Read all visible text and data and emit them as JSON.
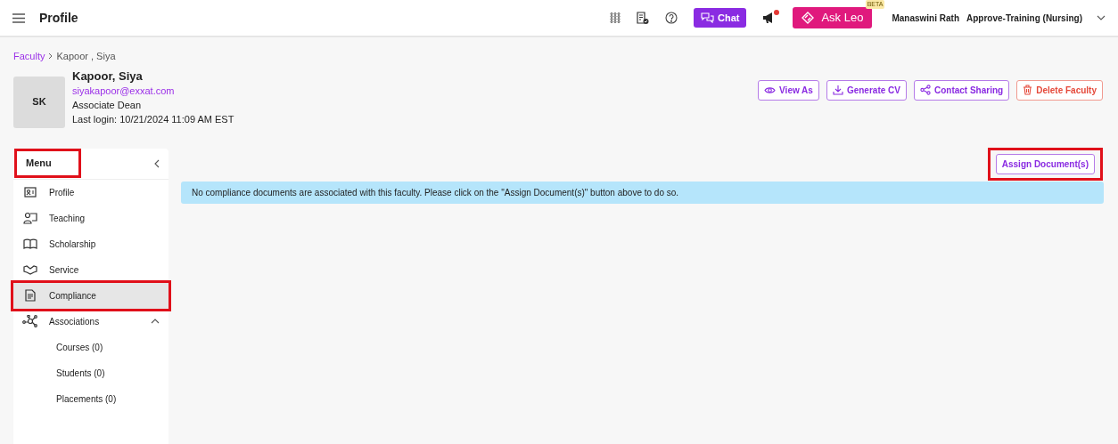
{
  "header": {
    "title": "Profile",
    "chat_label": "Chat",
    "notification_dot": true,
    "ask_label": "Ask Leo",
    "beta_badge": "BETA",
    "user_name": "Manaswini Rath",
    "role": "Approve-Training (Nursing)"
  },
  "breadcrumb": [
    {
      "label": "Faculty",
      "link": true
    },
    {
      "label": "Kapoor , Siya",
      "link": false
    }
  ],
  "profile": {
    "initials": "SK",
    "name": "Kapoor, Siya",
    "email": "siyakapoor@exxat.com",
    "title": "Associate Dean",
    "last_login": "Last login: 10/21/2024 11:09 AM EST"
  },
  "actions": [
    {
      "label": "View As",
      "danger": false
    },
    {
      "label": "Generate CV",
      "danger": false
    },
    {
      "label": "Contact Sharing",
      "danger": false
    },
    {
      "label": "Delete Faculty",
      "danger": true
    }
  ],
  "sidebar": {
    "title": "Menu",
    "highlighted": true,
    "items": [
      {
        "label": "Profile",
        "selected": false,
        "highlighted": false
      },
      {
        "label": "Teaching",
        "selected": false,
        "highlighted": false
      },
      {
        "label": "Scholarship",
        "selected": false,
        "highlighted": false
      },
      {
        "label": "Service",
        "selected": false,
        "highlighted": false
      },
      {
        "label": "Compliance",
        "selected": true,
        "highlighted": true
      },
      {
        "label": "Associations",
        "selected": false,
        "highlighted": false,
        "expanded": true,
        "children": [
          {
            "label": "Courses (0)"
          },
          {
            "label": "Students (0)"
          },
          {
            "label": "Placements (0)"
          }
        ]
      }
    ]
  },
  "main": {
    "assign_button": {
      "label": "Assign Document(s)",
      "highlighted": true
    },
    "alert": "No compliance documents are associated with this faculty. Please click on the \"Assign Document(s)\" button above to do so."
  }
}
